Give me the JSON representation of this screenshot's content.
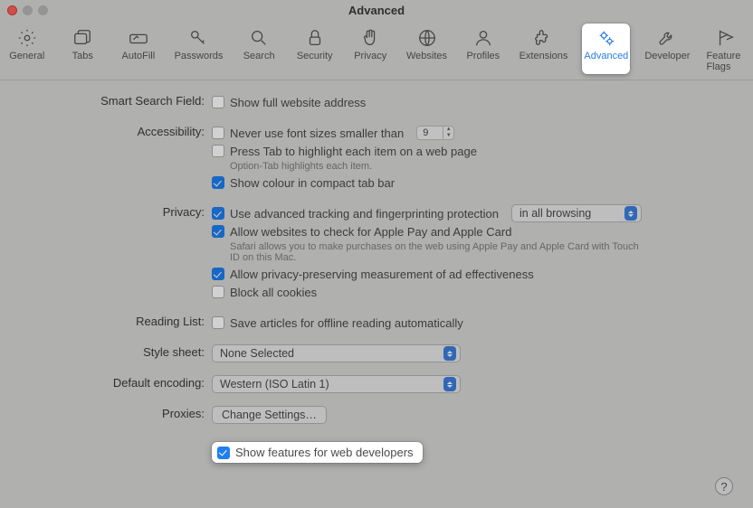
{
  "window": {
    "title": "Advanced"
  },
  "toolbar": {
    "items": [
      {
        "label": "General"
      },
      {
        "label": "Tabs"
      },
      {
        "label": "AutoFill"
      },
      {
        "label": "Passwords"
      },
      {
        "label": "Search"
      },
      {
        "label": "Security"
      },
      {
        "label": "Privacy"
      },
      {
        "label": "Websites"
      },
      {
        "label": "Profiles"
      },
      {
        "label": "Extensions"
      },
      {
        "label": "Advanced"
      },
      {
        "label": "Developer"
      },
      {
        "label": "Feature Flags"
      }
    ]
  },
  "sections": {
    "smart_label": "Smart Search Field:",
    "smart_show_full": "Show full website address",
    "access_label": "Accessibility:",
    "access_font": "Never use font sizes smaller than",
    "access_font_value": "9",
    "access_tab": "Press Tab to highlight each item on a web page",
    "access_tab_hint": "Option-Tab highlights each item.",
    "access_color": "Show colour in compact tab bar",
    "privacy_label": "Privacy:",
    "privacy_tracking": "Use advanced tracking and fingerprinting protection",
    "privacy_tracking_scope": "in all browsing",
    "privacy_applepay": "Allow websites to check for Apple Pay and Apple Card",
    "privacy_applepay_hint": "Safari allows you to make purchases on the web using Apple Pay and Apple Card with Touch ID on this Mac.",
    "privacy_ad": "Allow privacy-preserving measurement of ad effectiveness",
    "privacy_block": "Block all cookies",
    "reading_label": "Reading List:",
    "reading_save": "Save articles for offline reading automatically",
    "style_label": "Style sheet:",
    "style_value": "None Selected",
    "encoding_label": "Default encoding:",
    "encoding_value": "Western (ISO Latin 1)",
    "proxies_label": "Proxies:",
    "proxies_btn": "Change Settings…",
    "dev_features": "Show features for web developers"
  },
  "help": "?"
}
